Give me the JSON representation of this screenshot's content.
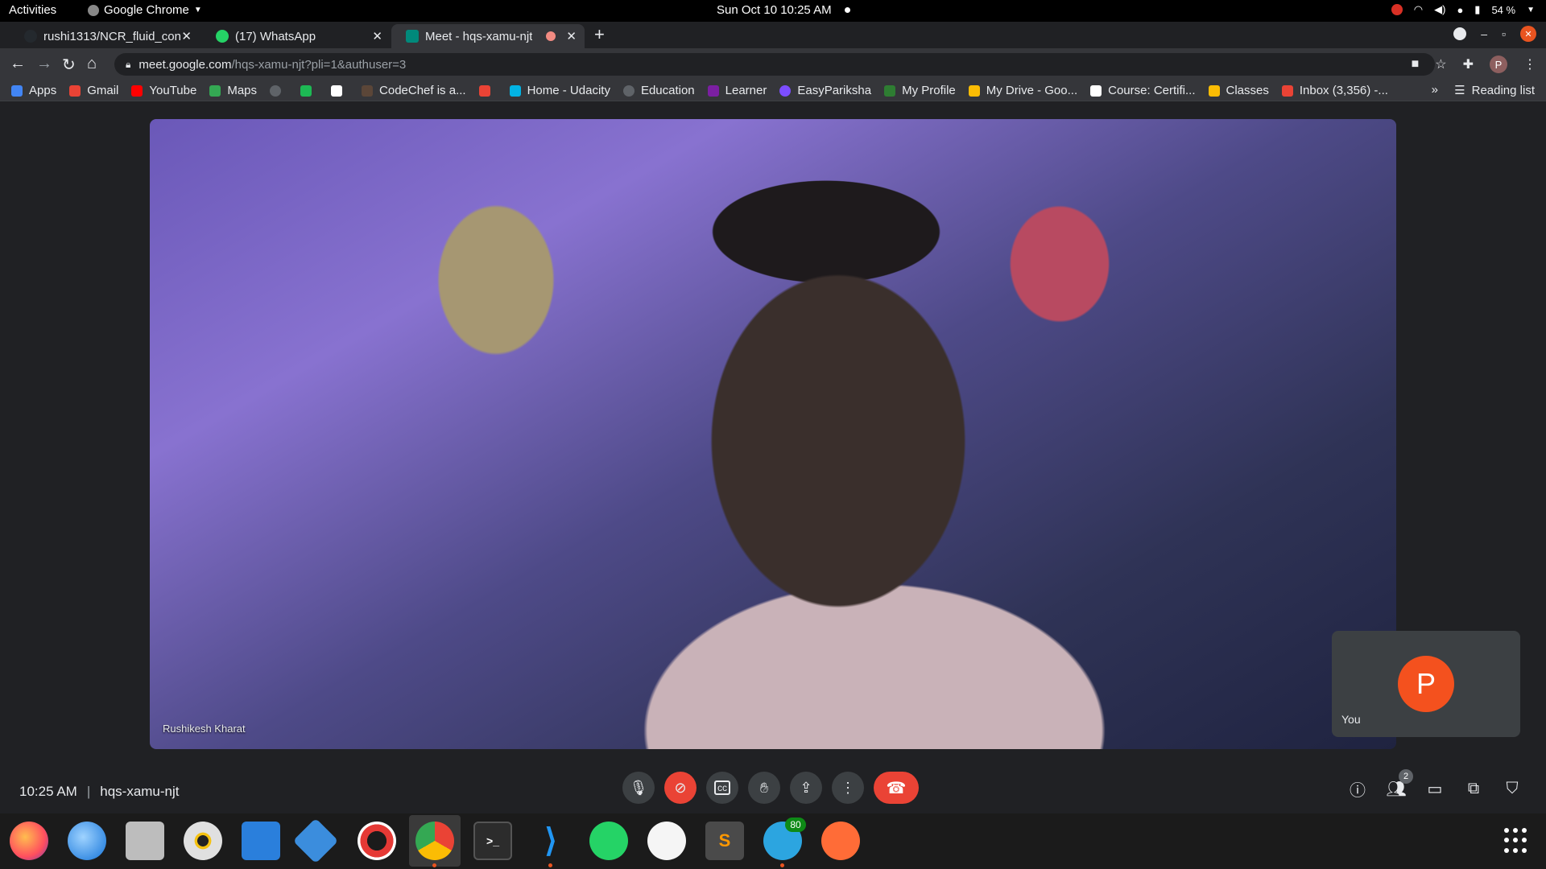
{
  "topbar": {
    "activities": "Activities",
    "app_name": "Google Chrome",
    "datetime": "Sun Oct 10  10:25 AM",
    "battery": "54 %"
  },
  "tabs": [
    {
      "title": "rushi1313/NCR_fluid_con",
      "favicon_color": "#24292e"
    },
    {
      "title": "(17) WhatsApp",
      "favicon_color": "#25d366"
    },
    {
      "title": "Meet - hqs-xamu-njt",
      "favicon_color": "#00897b"
    }
  ],
  "address": {
    "host": "meet.google.com",
    "path": "/hqs-xamu-njt?pli=1&authuser=3"
  },
  "profile_initial": "P",
  "bookmarks": [
    {
      "label": "Apps",
      "color": "#4285f4"
    },
    {
      "label": "Gmail",
      "color": "#ea4335"
    },
    {
      "label": "YouTube",
      "color": "#ff0000"
    },
    {
      "label": "Maps",
      "color": "#34a853"
    },
    {
      "label": "",
      "color": "#5f6368"
    },
    {
      "label": "",
      "color": "#1db954"
    },
    {
      "label": "",
      "color": "#ffffff"
    },
    {
      "label": "CodeChef is a...",
      "color": "#5b4638"
    },
    {
      "label": "",
      "color": "#ea4335"
    },
    {
      "label": "Home - Udacity",
      "color": "#02b3e4"
    },
    {
      "label": "Education",
      "color": "#5f6368"
    },
    {
      "label": "Learner",
      "color": "#7b1fa2"
    },
    {
      "label": "EasyPariksha",
      "color": "#7c4dff"
    },
    {
      "label": "My Profile",
      "color": "#2e7d32"
    },
    {
      "label": "My Drive - Goo...",
      "color": "#fbbc04"
    },
    {
      "label": "Course: Certifi...",
      "color": "#ffffff"
    },
    {
      "label": "Classes",
      "color": "#fbbc04"
    },
    {
      "label": "Inbox (3,356) -...",
      "color": "#ea4335"
    }
  ],
  "reading_list": "Reading list",
  "meet": {
    "participant_name": "Rushikesh Kharat",
    "self_label": "You",
    "self_initial": "P",
    "time": "10:25 AM",
    "separator": "|",
    "meeting_code": "hqs-xamu-njt",
    "people_count": "2"
  },
  "dock": {
    "telegram_badge": "80"
  }
}
